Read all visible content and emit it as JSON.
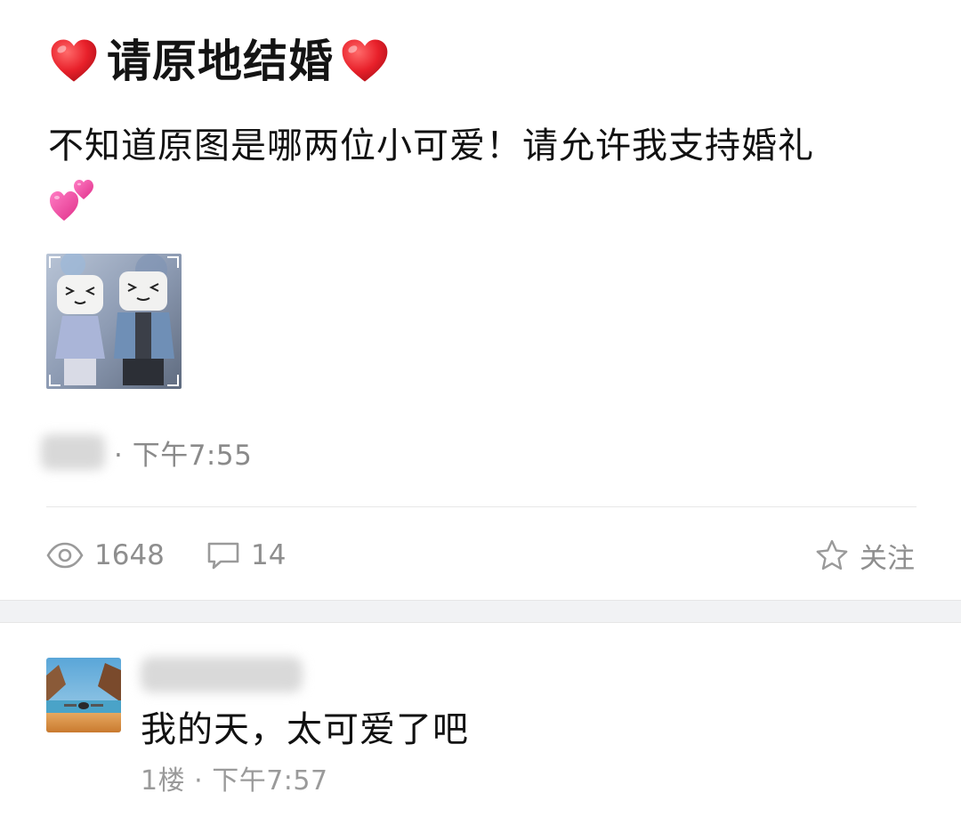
{
  "post": {
    "title": "请原地结婚",
    "body": "不知道原图是哪两位小可爱！请允许我支持婚礼",
    "time": "· 下午7:55",
    "stats": {
      "views": "1648",
      "comments": "14",
      "follow_label": "关注"
    },
    "icons": {
      "title_left": "red-heart-icon",
      "title_right": "red-heart-icon",
      "body_emoji": "two-hearts-icon",
      "views": "eye-icon",
      "comments": "comment-bubble-icon",
      "follow": "star-icon"
    }
  },
  "comment": {
    "text": "我的天，太可爱了吧",
    "meta": "1楼 · 下午7:57"
  },
  "colors": {
    "heart_red": "#e8202a",
    "emoji_pink": "#f04fa5",
    "secondary_text": "#8e8e8e",
    "divider": "#e8e8e8",
    "gap_bar": "#f1f2f4"
  }
}
